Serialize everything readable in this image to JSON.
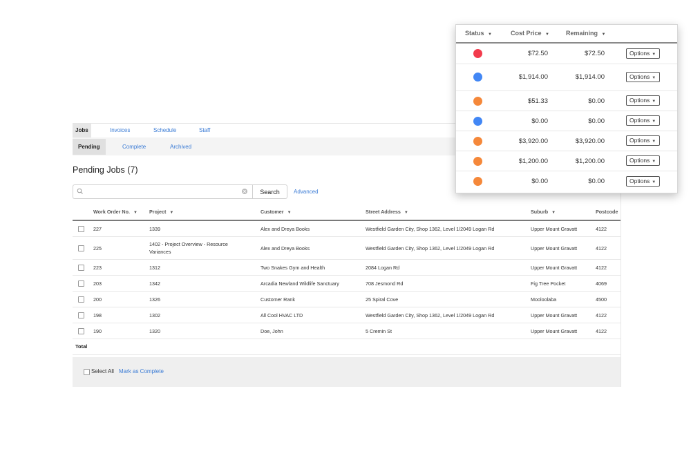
{
  "nav": {
    "tabs": [
      {
        "label": "Jobs",
        "active": true
      },
      {
        "label": "Invoices",
        "active": false
      },
      {
        "label": "Schedule",
        "active": false
      },
      {
        "label": "Staff",
        "active": false
      }
    ],
    "subtabs": [
      {
        "label": "Pending",
        "active": true
      },
      {
        "label": "Complete",
        "active": false
      },
      {
        "label": "Archived",
        "active": false
      }
    ]
  },
  "page": {
    "title": "Pending Jobs (7)"
  },
  "search": {
    "placeholder": "",
    "value": "",
    "button_label": "Search",
    "advanced_label": "Advanced"
  },
  "table": {
    "columns": [
      "Work Order No.",
      "Project",
      "Customer",
      "Street Address",
      "Suburb",
      "Postcode"
    ],
    "rows": [
      {
        "wo": "227",
        "project": "1339",
        "customer": "Alex and Dreya Books",
        "address": "Westfield Garden City, Shop 1362, Level 1/2049 Logan Rd",
        "suburb": "Upper Mount Gravatt",
        "postcode": "4122"
      },
      {
        "wo": "225",
        "project": "1402 - Project Overview - Resource Variances",
        "customer": "Alex and Dreya Books",
        "address": "Westfield Garden City, Shop 1362, Level 1/2049 Logan Rd",
        "suburb": "Upper Mount Gravatt",
        "postcode": "4122"
      },
      {
        "wo": "223",
        "project": "1312",
        "customer": "Two Snakes Gym and Health",
        "address": "2084 Logan Rd",
        "suburb": "Upper Mount Gravatt",
        "postcode": "4122"
      },
      {
        "wo": "203",
        "project": "1342",
        "customer": "Arcadia Newland Wildlife Sanctuary",
        "address": "708 Jesmond Rd",
        "suburb": "Fig Tree Pocket",
        "postcode": "4069"
      },
      {
        "wo": "200",
        "project": "1326",
        "customer": "Customer Rank",
        "address": "25 Spiral Cove",
        "suburb": "Mooloolaba",
        "postcode": "4500"
      },
      {
        "wo": "198",
        "project": "1302",
        "customer": "All Cool HVAC LTD",
        "address": "Westfield Garden City, Shop 1362, Level 1/2049 Logan Rd",
        "suburb": "Upper Mount Gravatt",
        "postcode": "4122"
      },
      {
        "wo": "190",
        "project": "1320",
        "customer": "Doe, John",
        "address": "5 Cremin St",
        "suburb": "Upper Mount Gravatt",
        "postcode": "4122"
      }
    ],
    "total_label": "Total"
  },
  "footer": {
    "select_all_label": "Select All",
    "mark_complete_label": "Mark as Complete"
  },
  "popup": {
    "columns": [
      "Status",
      "Cost Price",
      "Remaining"
    ],
    "rows": [
      {
        "status": "red",
        "cost": "$72.50",
        "remaining": "$72.50",
        "options": "Options"
      },
      {
        "status": "blue",
        "cost": "$1,914.00",
        "remaining": "$1,914.00",
        "options": "Options"
      },
      {
        "status": "orange",
        "cost": "$51.33",
        "remaining": "$0.00",
        "options": "Options"
      },
      {
        "status": "blue",
        "cost": "$0.00",
        "remaining": "$0.00",
        "options": "Options"
      },
      {
        "status": "orange",
        "cost": "$3,920.00",
        "remaining": "$3,920.00",
        "options": "Options"
      },
      {
        "status": "orange",
        "cost": "$1,200.00",
        "remaining": "$1,200.00",
        "options": "Options"
      },
      {
        "status": "orange",
        "cost": "$0.00",
        "remaining": "$0.00",
        "options": "Options"
      }
    ]
  },
  "colors": {
    "red": "#f23b4c",
    "blue": "#4287f5",
    "orange": "#f5883a",
    "link": "#3a7bd5"
  }
}
